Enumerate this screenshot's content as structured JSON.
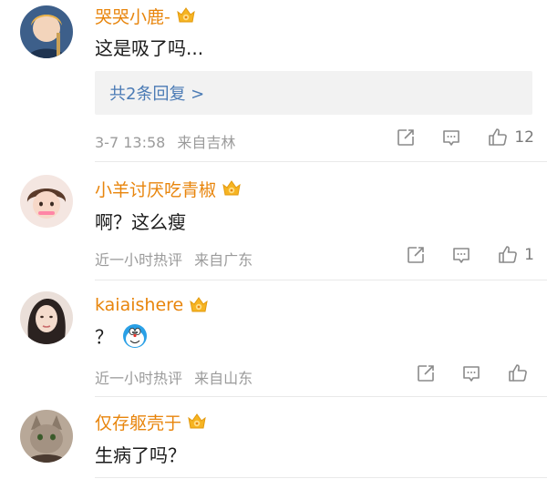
{
  "comments": [
    {
      "username": "哭哭小鹿-",
      "content": "这是吸了吗...",
      "reply_link": "共2条回复 >",
      "time": "3-7 13:58",
      "location": "来自吉林",
      "likes": "12"
    },
    {
      "username": "小羊讨厌吃青椒",
      "content": "啊？这么瘦",
      "time": "近一小时热评",
      "location": "来自广东",
      "likes": "1"
    },
    {
      "username": "kaiaishere",
      "content": "？",
      "emoji": "doraemon-emoji",
      "time": "近一小时热评",
      "location": "来自山东",
      "likes": ""
    },
    {
      "username": "仅存躯壳于",
      "content": "生病了吗？"
    }
  ],
  "icons": {
    "share": "share-icon",
    "comment": "comment-icon",
    "like": "thumbs-up-icon",
    "vip": "vip-crown-badge-icon"
  },
  "colors": {
    "username": "#e8850c",
    "reply_link": "#4b7bb5",
    "meta": "#9b9b9b",
    "reply_bg": "#f2f2f2"
  }
}
